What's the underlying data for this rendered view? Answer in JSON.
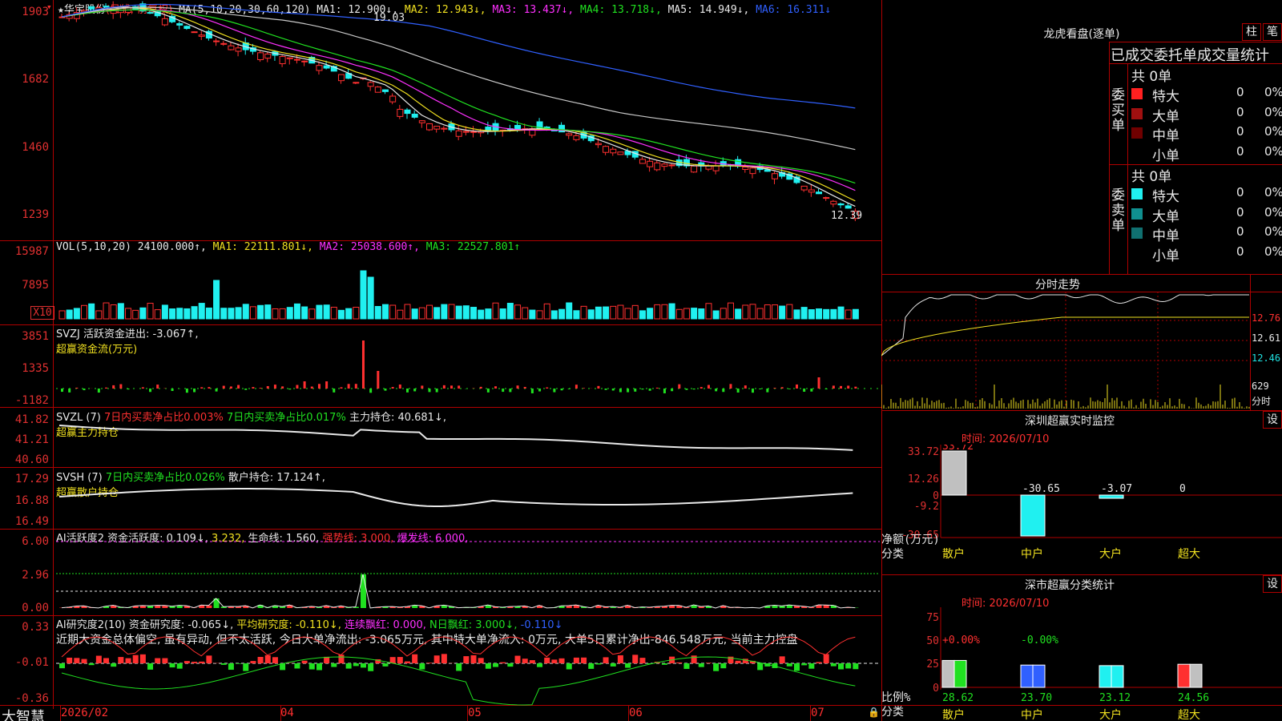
{
  "main": {
    "header": {
      "star": "★",
      "name": "华宝股份",
      "mode": "(日线, 前复权)",
      "ma_params": "MA(5,10,20,30,60,120)",
      "ma1": "MA1: 12.900↓,",
      "ma2": "MA2: 12.943↓,",
      "ma3": "MA3: 13.437↓,",
      "ma4": "MA4: 13.718↓,",
      "ma5": "MA5: 14.949↓,",
      "ma6": "MA6: 16.311↓"
    },
    "axis": [
      "1903",
      "1682",
      "1460",
      "1239"
    ],
    "high_mark": "19.03",
    "low_mark": "12.39"
  },
  "vol": {
    "header": {
      "title": "VOL(5,10,20)",
      "value": "24100.000↑,",
      "ma1": "MA1: 22111.801↓,",
      "ma2": "MA2: 25038.600↑,",
      "ma3": "MA3: 22527.801↑"
    },
    "axis": [
      "15987",
      "7895"
    ],
    "unit": "X10"
  },
  "svzj": {
    "header": {
      "title": "SVZJ",
      "desc": "活跃资金进出: -3.067↑,",
      "sub": "超赢资金流(万元)"
    },
    "axis": [
      "3851",
      "1335",
      "-1182"
    ]
  },
  "svzl": {
    "header": {
      "title": "SVZL (7)",
      "a": "7日内买卖净占比0.003%",
      "b": "7日内买卖净占比0.017%",
      "c": "主力持仓: 40.681↓,",
      "sub": "超赢主力持仓"
    },
    "axis": [
      "41.82",
      "41.21",
      "40.60"
    ]
  },
  "svsh": {
    "header": {
      "title": "SVSH (7)",
      "a": "7日内买卖净占比0.026%",
      "b": "散户持仓: 17.124↑,",
      "sub": "超赢散户持仓"
    },
    "axis": [
      "17.29",
      "16.88",
      "16.49"
    ]
  },
  "ai1": {
    "header": {
      "title": "AI活跃度2",
      "a": "资金活跃度: 0.109↓,",
      "b": "3.232,",
      "c": "生命线: 1.560,",
      "d": "强势线: 3.000,",
      "e": "爆发线: 6.000,"
    },
    "axis": [
      "6.00",
      "2.96",
      "0.00"
    ]
  },
  "ai2": {
    "header": {
      "title": "AI研究度2(10)",
      "a": "资金研究度: -0.065↓,",
      "b": "平均研究度: -0.110↓,",
      "c": "连续飘红: 0.000,",
      "d": "N日飘红: 3.000↓,",
      "e": "-0.110↓"
    },
    "text": "近期大资金总体偏空, 虽有异动, 但不太活跃, 今日大单净流出: -3.065万元, 其中特大单净流入: 0万元, 大单5日累计净出-846.548万元, 当前主力控盘",
    "axis": [
      "0.33",
      "-0.01",
      "-0.36"
    ]
  },
  "bottom": {
    "brand": "大智慧",
    "dates": [
      "2026/02",
      "04",
      "05",
      "06",
      "07"
    ]
  },
  "dragon": {
    "title": "龙虎看盘(逐单)",
    "tab1": "柱",
    "tab2": "笔",
    "subtitle": "已成交委托单成交量统计",
    "buy": {
      "label": "委买单",
      "total": "共 0单",
      "rows": [
        {
          "name": "特大",
          "v": "0",
          "p": "0%",
          "color": "#ff2020"
        },
        {
          "name": "大单",
          "v": "0",
          "p": "0%",
          "color": "#a01010"
        },
        {
          "name": "中单",
          "v": "0",
          "p": "0%",
          "color": "#700000"
        },
        {
          "name": "小单",
          "v": "0",
          "p": "0%",
          "color": "#000000"
        }
      ]
    },
    "sell": {
      "label": "委卖单",
      "total": "共 0单",
      "rows": [
        {
          "name": "特大",
          "v": "0",
          "p": "0%",
          "color": "#20f0f0"
        },
        {
          "name": "大单",
          "v": "0",
          "p": "0%",
          "color": "#109090"
        },
        {
          "name": "中单",
          "v": "0",
          "p": "0%",
          "color": "#107070"
        },
        {
          "name": "小单",
          "v": "0",
          "p": "0%",
          "color": "#000000"
        }
      ]
    }
  },
  "minute": {
    "title": "分时走势",
    "axis": [
      "12.76",
      "12.61",
      "12.46"
    ],
    "vol": "629",
    "vol_unit": "分时"
  },
  "szmon": {
    "title": "深圳超赢实时监控",
    "set": "设",
    "time": "时间: 2026/07/10",
    "axis": [
      "33.72",
      "12.26",
      "0",
      "-9.2",
      "-30.65"
    ],
    "ylab": "净额(万元)",
    "xlab": "分类",
    "cats": [
      "散户",
      "中户",
      "大户",
      "超大"
    ],
    "vals": [
      "33.72",
      "-30.65",
      "-3.07",
      "0"
    ]
  },
  "szstat": {
    "title": "深市超赢分类统计",
    "set": "设",
    "time": "时间: 2026/07/10",
    "axis": [
      "75",
      "50",
      "25",
      "0"
    ],
    "ylab": "比例%",
    "xlab": "分类",
    "cats": [
      "散户",
      "中户",
      "大户",
      "超大"
    ],
    "top": [
      "+0.00%",
      "-0.00%"
    ],
    "vals": [
      "28.62",
      "23.70",
      "23.12",
      "24.56"
    ]
  },
  "colors": {
    "up": "#ff3030",
    "down": "#20f0f0",
    "grid": "#b00000"
  }
}
